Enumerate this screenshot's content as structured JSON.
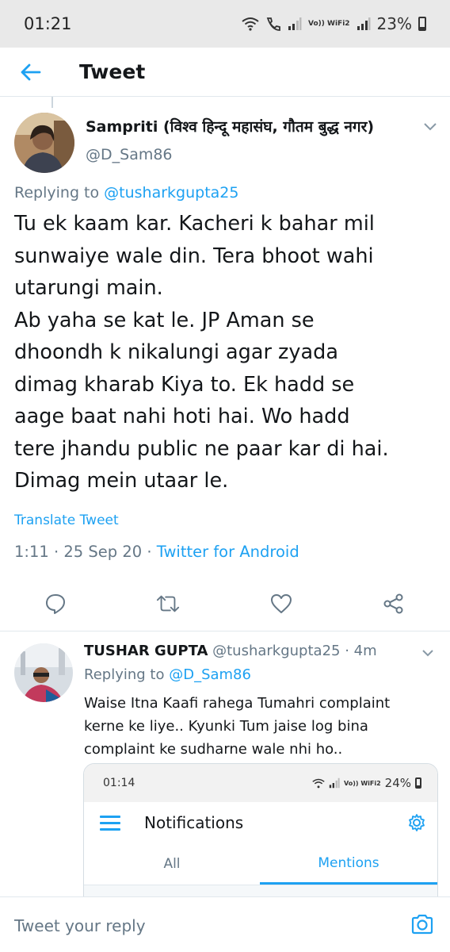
{
  "status_bar": {
    "time": "01:21",
    "network": "Vo)) WiFi2",
    "battery": "23%"
  },
  "header": {
    "title": "Tweet"
  },
  "tweet": {
    "author_name": "Sampriti (विश्व हिन्दू महासंघ, गौतम बुद्ध नगर)",
    "author_handle": "@D_Sam86",
    "replying_prefix": "Replying to ",
    "replying_to": "@tusharkgupta25",
    "lines": [
      "Tu ek kaam kar. Kacheri k bahar mil",
      "sunwaiye wale din. Tera bhoot wahi",
      "utarungi main.",
      "Ab yaha se kat le. JP Aman se",
      "dhoondh k nikalungi agar zyada",
      "dimag kharab Kiya to. Ek hadd se",
      "aage baat nahi hoti hai. Wo hadd",
      "tere jhandu public ne paar kar di hai.",
      "Dimag mein utaar le."
    ],
    "translate_label": "Translate Tweet",
    "timestamp": "1:11 · 25 Sep 20 · ",
    "source": "Twitter for Android"
  },
  "actions": [
    "reply-icon",
    "retweet-icon",
    "like-icon",
    "share-icon"
  ],
  "reply": {
    "author_name": "TUSHAR GUPTA",
    "author_handle": "@tusharkgupta25",
    "time": " · 4m",
    "replying_prefix": "Replying to ",
    "replying_to": "@D_Sam86",
    "lines": [
      "Waise Itna Kaafi rahega Tumahri complaint",
      "kerne ke liye.. Kyunki Tum jaise log bina",
      "complaint ke sudharne wale nhi ho.."
    ],
    "embed": {
      "time": "01:14",
      "network": "Vo)) WiFi2",
      "battery": "24%",
      "title": "Notifications",
      "tabs": [
        "All",
        "Mentions"
      ],
      "active_tab": "Mentions"
    }
  },
  "composer": {
    "placeholder": "Tweet your reply"
  },
  "colors": {
    "accent": "#1da1f2",
    "secondary_text": "#657786",
    "primary_text": "#14171a"
  }
}
